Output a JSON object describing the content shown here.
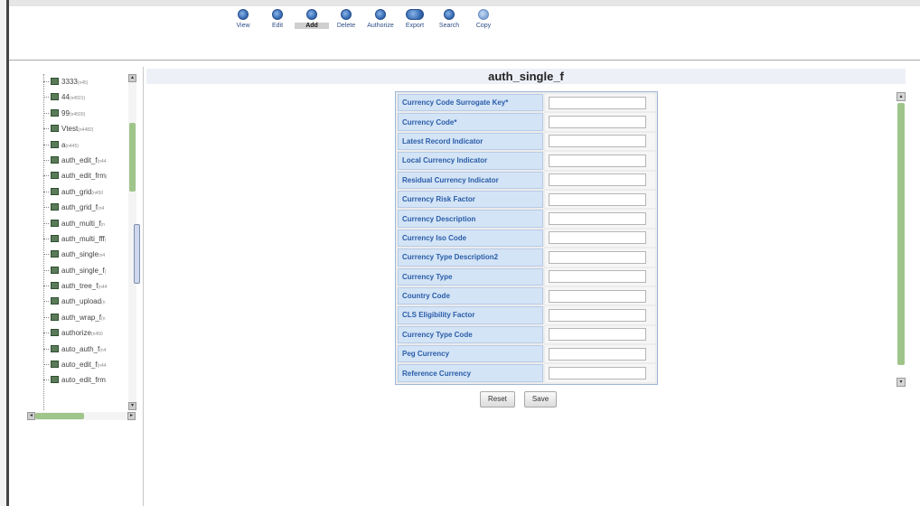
{
  "toolbar": {
    "items": [
      {
        "label": "View",
        "icon": "view-icon"
      },
      {
        "label": "Edit",
        "icon": "edit-icon"
      },
      {
        "label": "Add",
        "icon": "add-icon"
      },
      {
        "label": "Delete",
        "icon": "delete-icon"
      },
      {
        "label": "Authorize",
        "icon": "authorize-icon"
      },
      {
        "label": "Export",
        "icon": "export-icon"
      },
      {
        "label": "Search",
        "icon": "search-icon"
      },
      {
        "label": "Copy",
        "icon": "copy-icon"
      }
    ],
    "active": "Add"
  },
  "tree": {
    "items": [
      {
        "label": "3333",
        "meta": "(n45)"
      },
      {
        "label": "44",
        "meta": "(n4501)"
      },
      {
        "label": "99",
        "meta": "(n4500)"
      },
      {
        "label": "Vtest",
        "meta": "(n4482)"
      },
      {
        "label": "a",
        "meta": "(n445)"
      },
      {
        "label": "auth_edit_f",
        "meta": "(n44"
      },
      {
        "label": "auth_edit_frm",
        "meta": "("
      },
      {
        "label": "auth_grid",
        "meta": "(n450"
      },
      {
        "label": "auth_grid_f",
        "meta": "(n4"
      },
      {
        "label": "auth_multi_f",
        "meta": "(n"
      },
      {
        "label": "auth_multi_fff",
        "meta": "("
      },
      {
        "label": "auth_single",
        "meta": "(n4"
      },
      {
        "label": "auth_single_f",
        "meta": "("
      },
      {
        "label": "auth_tree_f",
        "meta": "(n44"
      },
      {
        "label": "auth_upload",
        "meta": "(n"
      },
      {
        "label": "auth_wrap_f",
        "meta": "(n"
      },
      {
        "label": "authorize",
        "meta": "(n450"
      },
      {
        "label": "auto_auth_f",
        "meta": "(n4"
      },
      {
        "label": "auto_edit_f",
        "meta": "(n44"
      },
      {
        "label": "auto_edit_frm",
        "meta": ""
      }
    ]
  },
  "form": {
    "title": "auth_single_f",
    "fields": [
      {
        "label": "Currency Code Surrogate Key*",
        "value": ""
      },
      {
        "label": "Currency Code*",
        "value": ""
      },
      {
        "label": "Latest Record Indicator",
        "value": ""
      },
      {
        "label": "Local Currency Indicator",
        "value": ""
      },
      {
        "label": "Residual Currency Indicator",
        "value": ""
      },
      {
        "label": "Currency Risk Factor",
        "value": ""
      },
      {
        "label": "Currency Description",
        "value": ""
      },
      {
        "label": "Currency Iso Code",
        "value": ""
      },
      {
        "label": "Currency Type Description2",
        "value": ""
      },
      {
        "label": "Currency Type",
        "value": ""
      },
      {
        "label": "Country Code",
        "value": ""
      },
      {
        "label": "CLS Eligibility Factor",
        "value": ""
      },
      {
        "label": "Currency Type Code",
        "value": ""
      },
      {
        "label": "Peg Currency",
        "value": ""
      },
      {
        "label": "Reference Currency",
        "value": ""
      }
    ],
    "reset_label": "Reset",
    "save_label": "Save"
  },
  "colors": {
    "label_bg": "#d3e4f6",
    "label_text": "#2a5ca8",
    "scroll_thumb": "#9fc58a",
    "title_bar_bg": "#eef0f8"
  }
}
